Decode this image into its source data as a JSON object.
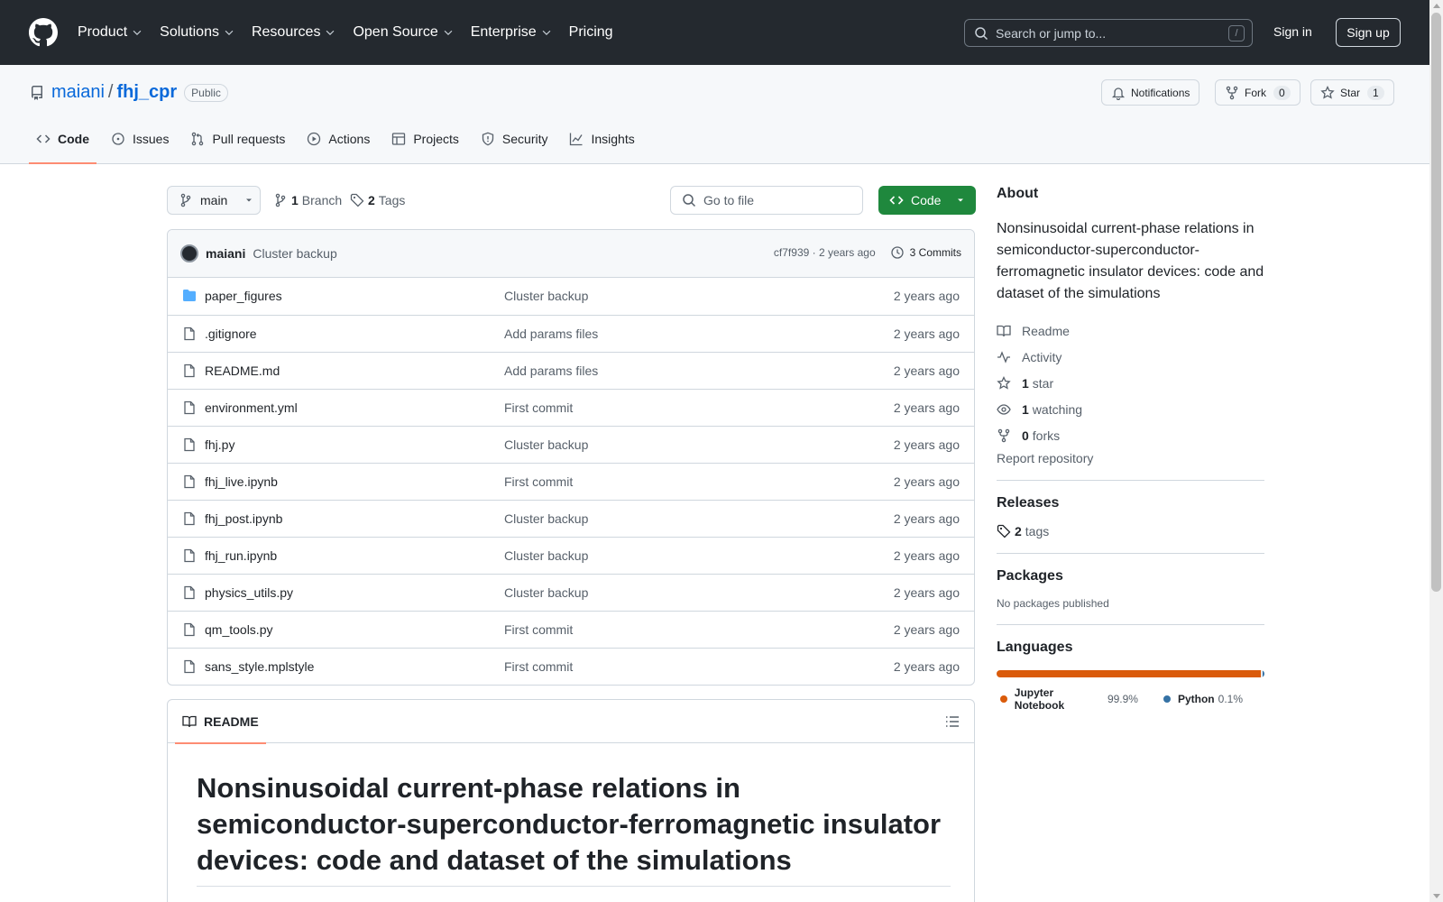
{
  "header": {
    "nav": [
      {
        "label": "Product",
        "dropdown": true
      },
      {
        "label": "Solutions",
        "dropdown": true
      },
      {
        "label": "Resources",
        "dropdown": true
      },
      {
        "label": "Open Source",
        "dropdown": true
      },
      {
        "label": "Enterprise",
        "dropdown": true
      },
      {
        "label": "Pricing",
        "dropdown": false
      }
    ],
    "search_placeholder": "Search or jump to...",
    "search_shortcut": "/",
    "sign_in": "Sign in",
    "sign_up": "Sign up"
  },
  "repo": {
    "owner": "maiani",
    "separator": "/",
    "name": "fhj_cpr",
    "visibility": "Public",
    "notifications_label": "Notifications",
    "fork_label": "Fork",
    "fork_count": "0",
    "star_label": "Star",
    "star_count": "1"
  },
  "tabs": [
    {
      "label": "Code",
      "icon": "code-icon",
      "active": true
    },
    {
      "label": "Issues",
      "icon": "issue-icon",
      "active": false
    },
    {
      "label": "Pull requests",
      "icon": "pull-request-icon",
      "active": false
    },
    {
      "label": "Actions",
      "icon": "play-icon",
      "active": false
    },
    {
      "label": "Projects",
      "icon": "table-icon",
      "active": false
    },
    {
      "label": "Security",
      "icon": "shield-icon",
      "active": false
    },
    {
      "label": "Insights",
      "icon": "graph-icon",
      "active": false
    }
  ],
  "toolbar": {
    "branch": "main",
    "branch_count": "1",
    "branch_label": "Branch",
    "tag_count": "2",
    "tag_label": "Tags",
    "go_to_file": "Go to file",
    "code_button": "Code"
  },
  "commit": {
    "author": "maiani",
    "message": "Cluster backup",
    "hash_time": "cf7f939 · 2 years ago",
    "commits_label": "3 Commits"
  },
  "files": [
    {
      "name": "paper_figures",
      "type": "folder",
      "message": "Cluster backup",
      "age": "2 years ago"
    },
    {
      "name": ".gitignore",
      "type": "file",
      "message": "Add params files",
      "age": "2 years ago"
    },
    {
      "name": "README.md",
      "type": "file",
      "message": "Add params files",
      "age": "2 years ago"
    },
    {
      "name": "environment.yml",
      "type": "file",
      "message": "First commit",
      "age": "2 years ago"
    },
    {
      "name": "fhj.py",
      "type": "file",
      "message": "Cluster backup",
      "age": "2 years ago"
    },
    {
      "name": "fhj_live.ipynb",
      "type": "file",
      "message": "First commit",
      "age": "2 years ago"
    },
    {
      "name": "fhj_post.ipynb",
      "type": "file",
      "message": "Cluster backup",
      "age": "2 years ago"
    },
    {
      "name": "fhj_run.ipynb",
      "type": "file",
      "message": "Cluster backup",
      "age": "2 years ago"
    },
    {
      "name": "physics_utils.py",
      "type": "file",
      "message": "Cluster backup",
      "age": "2 years ago"
    },
    {
      "name": "qm_tools.py",
      "type": "file",
      "message": "First commit",
      "age": "2 years ago"
    },
    {
      "name": "sans_style.mplstyle",
      "type": "file",
      "message": "First commit",
      "age": "2 years ago"
    }
  ],
  "readme": {
    "tab_label": "README",
    "heading": "Nonsinusoidal current-phase relations in semiconductor-superconductor-ferromagnetic insulator devices: code and dataset of the simulations"
  },
  "sidebar": {
    "about_title": "About",
    "description": "Nonsinusoidal current-phase relations in semiconductor-superconductor-ferromagnetic insulator devices: code and dataset of the simulations",
    "readme_link": "Readme",
    "activity_link": "Activity",
    "stars_count": "1",
    "stars_label": "star",
    "watching_count": "1",
    "watching_label": "watching",
    "forks_count": "0",
    "forks_label": "forks",
    "report": "Report repository",
    "releases_title": "Releases",
    "release_tags_count": "2",
    "release_tags_label": "tags",
    "packages_title": "Packages",
    "packages_none": "No packages published",
    "languages_title": "Languages",
    "languages": [
      {
        "name": "Jupyter Notebook",
        "percent": "99.9%",
        "value": 99.9,
        "color": "#DA5B0B"
      },
      {
        "name": "Python",
        "percent": "0.1%",
        "value": 0.1,
        "color": "#3572A5"
      }
    ]
  }
}
